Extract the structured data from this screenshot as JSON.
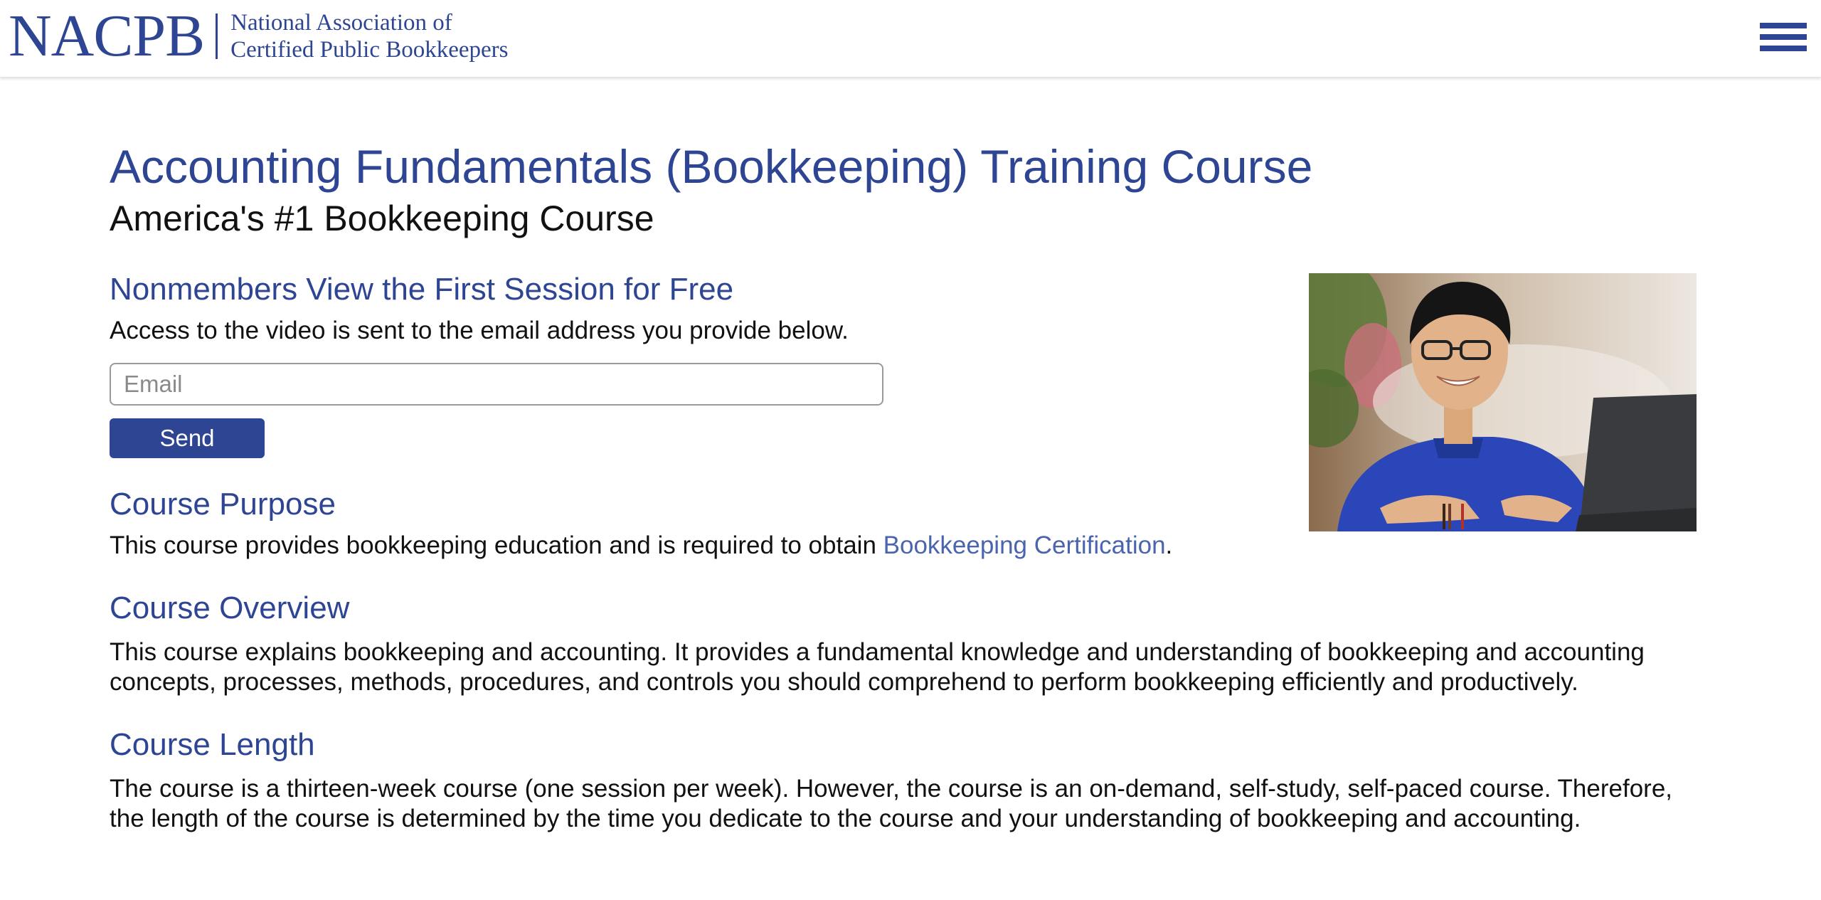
{
  "header": {
    "logo_abbr": "NACPB",
    "logo_line1": "National Association of",
    "logo_line2": "Certified Public Bookkeepers",
    "menu_icon": "hamburger-menu-icon"
  },
  "main": {
    "title": "Accounting Fundamentals (Bookkeeping) Training Course",
    "subtitle": "America's #1 Bookkeeping Course",
    "free_session": {
      "heading": "Nonmembers View the First Session for Free",
      "text": "Access to the video is sent to the email address you provide below.",
      "email_placeholder": "Email",
      "send_label": "Send"
    },
    "purpose": {
      "heading": "Course Purpose",
      "text_before": "This course provides bookkeeping education and is required to obtain ",
      "link_text": "Bookkeeping Certification",
      "text_after": "."
    },
    "overview": {
      "heading": "Course Overview",
      "text": "This course explains bookkeeping and accounting. It provides a fundamental knowledge and understanding of bookkeeping and accounting concepts, processes, methods, procedures, and controls you should comprehend to perform bookkeeping efficiently and productively."
    },
    "length": {
      "heading": "Course Length",
      "text": "The course is a thirteen-week course (one session per week). However, the course is an on-demand, self-study, self-paced course. Therefore, the length of the course is determined by the time you dedicate to the course and your understanding of bookkeeping and accounting."
    }
  },
  "colors": {
    "brand": "#2d4593",
    "link": "#4a64ad",
    "text": "#111111"
  }
}
